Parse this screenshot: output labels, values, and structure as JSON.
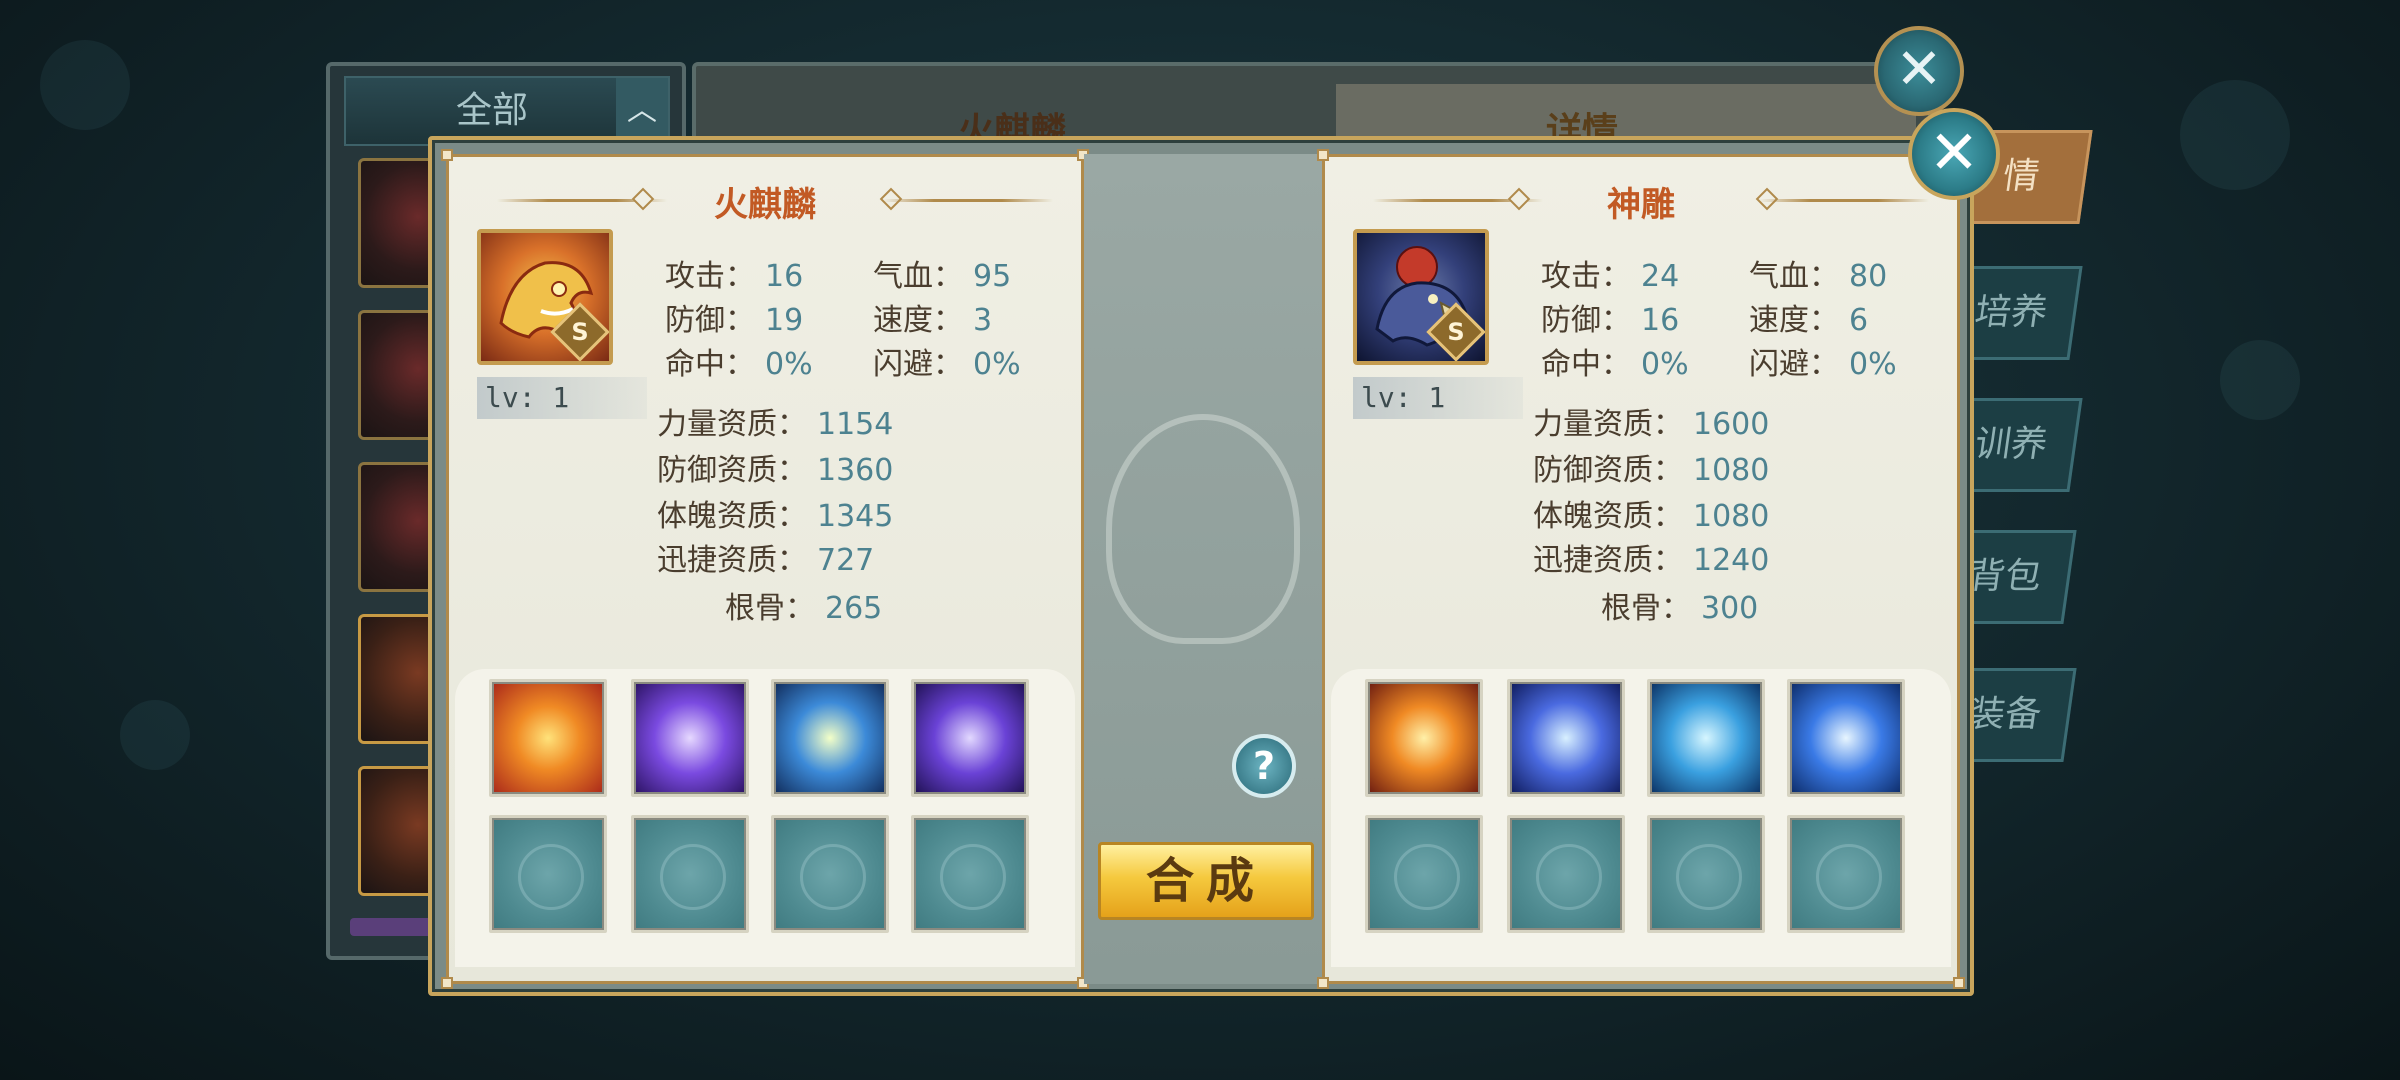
{
  "background": {
    "list_filter_label": "全部",
    "detail_title": "火麒麟",
    "detail_tab_title": "详情",
    "side_tabs": [
      "情",
      "培养",
      "训养",
      "背包",
      "装备"
    ]
  },
  "dialog": {
    "left": {
      "name": "火麒麟",
      "level": "lv: 1",
      "grade": "S",
      "stats": [
        {
          "label": "攻击：",
          "value": "16"
        },
        {
          "label": "气血：",
          "value": "95"
        },
        {
          "label": "防御：",
          "value": "19"
        },
        {
          "label": "速度：",
          "value": "3"
        },
        {
          "label": "命中：",
          "value": "0%"
        },
        {
          "label": "闪避：",
          "value": "0%"
        }
      ],
      "aptitudes": [
        {
          "label": "力量资质：",
          "value": "1154"
        },
        {
          "label": "防御资质：",
          "value": "1360"
        },
        {
          "label": "体魄资质：",
          "value": "1345"
        },
        {
          "label": "迅捷资质：",
          "value": "727"
        },
        {
          "label": "根骨：",
          "value": "265"
        }
      ],
      "skills": [
        "flame-burst-icon",
        "arcane-slash-icon",
        "lightning-shield-icon",
        "vortex-icon"
      ]
    },
    "right": {
      "name": "神雕",
      "level": "lv: 1",
      "grade": "S",
      "stats": [
        {
          "label": "攻击：",
          "value": "24"
        },
        {
          "label": "气血：",
          "value": "80"
        },
        {
          "label": "防御：",
          "value": "16"
        },
        {
          "label": "速度：",
          "value": "6"
        },
        {
          "label": "命中：",
          "value": "0%"
        },
        {
          "label": "闪避：",
          "value": "0%"
        }
      ],
      "aptitudes": [
        {
          "label": "力量资质：",
          "value": "1600"
        },
        {
          "label": "防御资质：",
          "value": "1080"
        },
        {
          "label": "体魄资质：",
          "value": "1080"
        },
        {
          "label": "迅捷资质：",
          "value": "1240"
        },
        {
          "label": "根骨：",
          "value": "300"
        }
      ],
      "skills": [
        "phoenix-fire-icon",
        "claw-slash-icon",
        "water-heart-icon",
        "ice-lightning-icon"
      ]
    },
    "help_label": "?",
    "compose_label": "合成",
    "close_label": "✕"
  },
  "colors": {
    "title": "#c25a24",
    "stat_value": "#4d8290",
    "frame_gold": "#c8a55c"
  }
}
